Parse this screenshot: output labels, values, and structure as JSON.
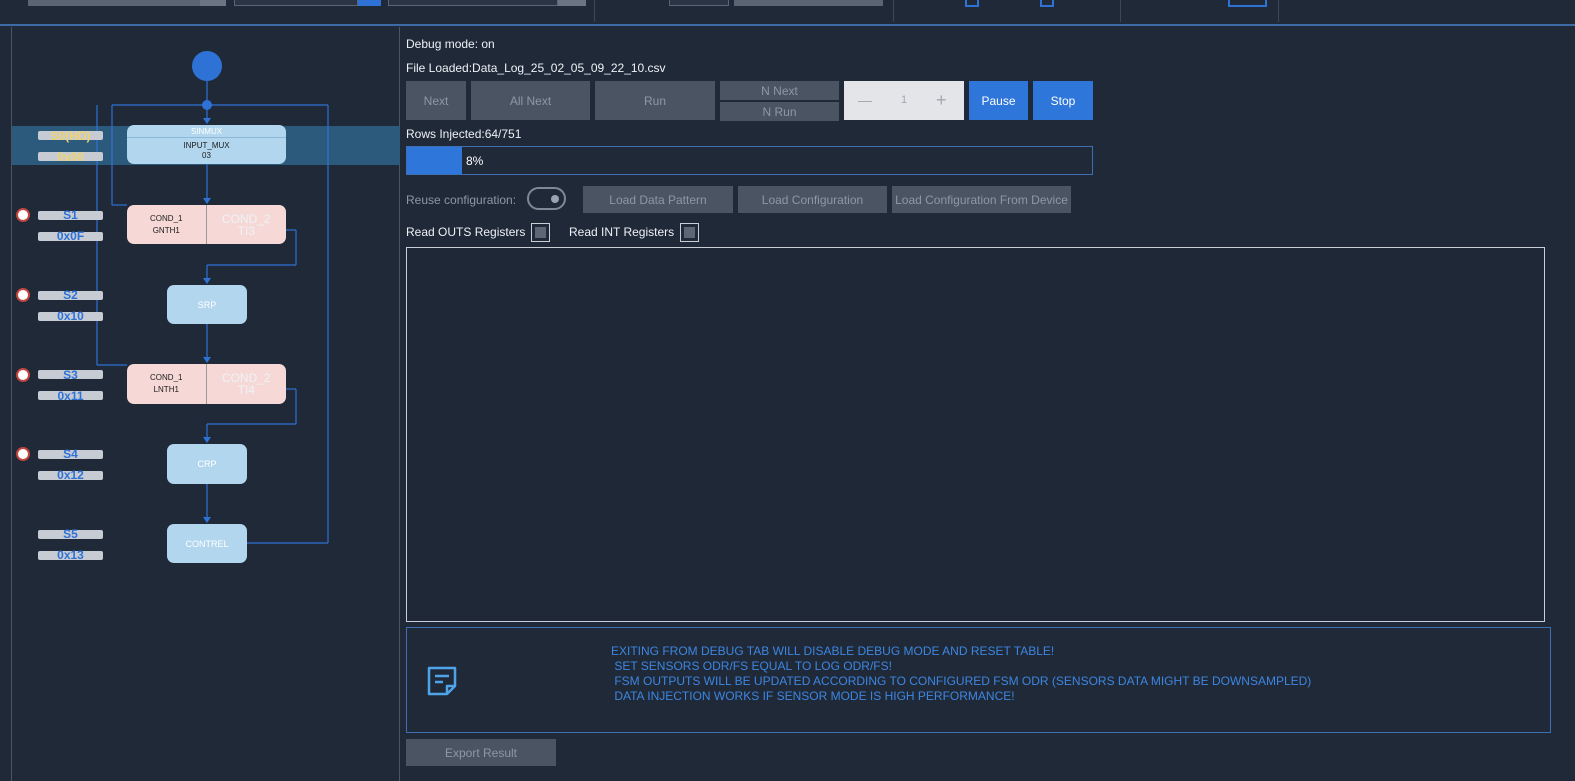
{
  "left_panel": {
    "start_node_title": "SINMUX",
    "start_node_sub": "INPUT_MUX",
    "start_node_val": "03",
    "highlight_row": {
      "label": "S0(HD)",
      "code": "0x00"
    },
    "rows": [
      {
        "label": "S1",
        "code": "0x0F"
      },
      {
        "label": "S2",
        "code": "0x10"
      },
      {
        "label": "S3",
        "code": "0x11"
      },
      {
        "label": "S4",
        "code": "0x12"
      },
      {
        "label": "S5",
        "code": "0x13"
      }
    ],
    "s1_node": {
      "cond1": "COND_1",
      "cond1_val": "GNTH1",
      "cond2": "COND_2",
      "cond2_val": "TI3"
    },
    "s2_node": "SRP",
    "s3_node": {
      "cond1": "COND_1",
      "cond1_val": "LNTH1",
      "cond2": "COND_2",
      "cond2_val": "TI4"
    },
    "s4_node": "CRP",
    "s5_node": "CONTREL"
  },
  "right_panel": {
    "debug_mode": "Debug mode: on",
    "file_loaded": "File Loaded:Data_Log_25_02_05_09_22_10.csv",
    "buttons": {
      "next": "Next",
      "all_next": "All Next",
      "run": "Run",
      "n_next": "N Next",
      "n_run": "N Run",
      "pause": "Pause",
      "stop": "Stop"
    },
    "stepper": {
      "minus": "—",
      "value": "1",
      "plus": "+"
    },
    "rows_injected": "Rows Injected:64/751",
    "progress": {
      "percent": 8,
      "label": "8%"
    },
    "reuse_label": "Reuse configuration:",
    "load_data_pattern": "Load Data Pattern",
    "load_configuration": "Load Configuration",
    "load_config_device": "Load Configuration From Device",
    "read_outs": "Read OUTS Registers",
    "read_int": "Read INT Registers",
    "notice_lines": [
      "EXITING FROM DEBUG TAB WILL DISABLE DEBUG MODE AND RESET TABLE!",
      " SET SENSORS ODR/FS EQUAL TO LOG ODR/FS!",
      " FSM OUTPUTS WILL BE UPDATED ACCORDING TO CONFIGURED FSM ODR (SENSORS DATA MIGHT BE DOWNSAMPLED)",
      " DATA INJECTION WORKS IF SENSOR MODE IS HIGH PERFORMANCE!"
    ],
    "export_result": "Export Result"
  },
  "colors": {
    "accent": "#2f76db",
    "background": "#202938",
    "warning_text": "#3d86e0"
  }
}
